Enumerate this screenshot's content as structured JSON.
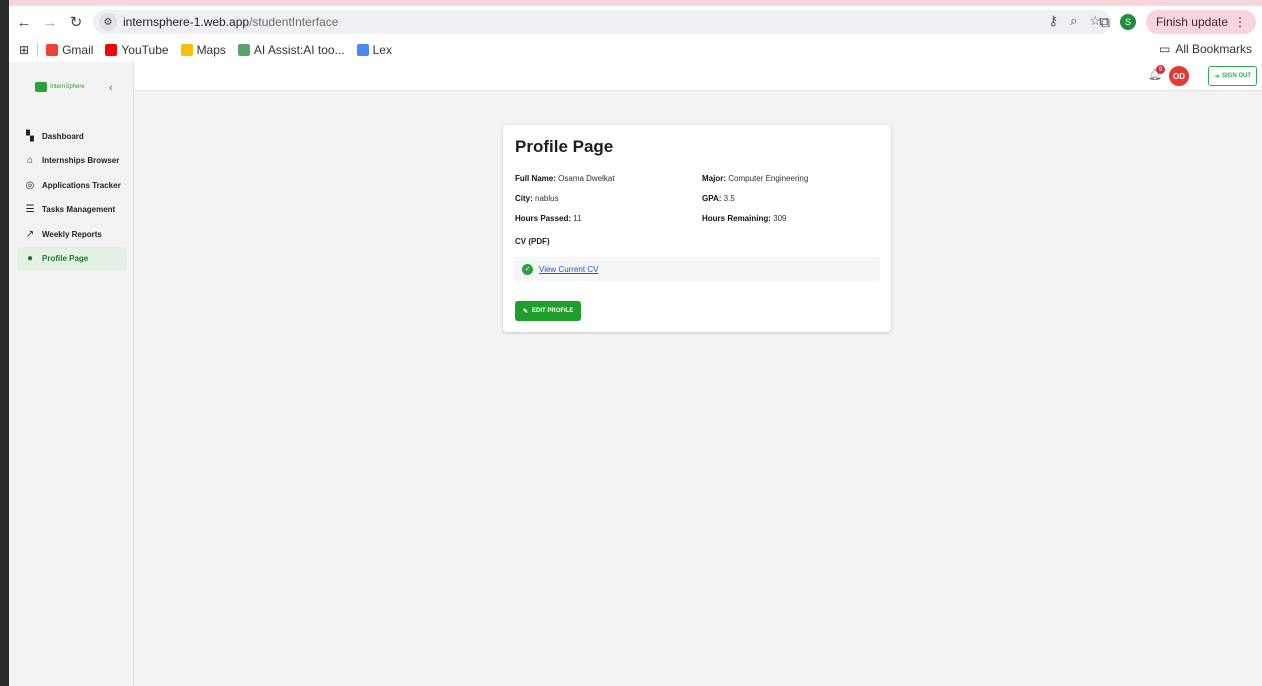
{
  "browser": {
    "url_host": "internsphere-1.web.app",
    "url_path": "/studentInterface",
    "profile_initial": "S",
    "finish_update_label": "Finish update",
    "bookmarks": [
      {
        "label": "Gmail",
        "color": "#ea4335"
      },
      {
        "label": "YouTube",
        "color": "#ff0000"
      },
      {
        "label": "Maps",
        "color": "#fbbc04"
      },
      {
        "label": "AI Assist:AI too...",
        "color": "#5aa469"
      },
      {
        "label": "Lex",
        "color": "#4a8af4"
      }
    ],
    "all_bookmarks_label": "All Bookmarks"
  },
  "app": {
    "brand_name": "InternSphere",
    "menu": [
      {
        "label": "Dashboard",
        "icon": "dashboard-icon",
        "glyph": "▚"
      },
      {
        "label": "Internships Browser",
        "icon": "briefcase-icon",
        "glyph": "⌂"
      },
      {
        "label": "Applications Tracker",
        "icon": "tracker-icon",
        "glyph": "◎"
      },
      {
        "label": "Tasks Management",
        "icon": "tasks-icon",
        "glyph": "☰"
      },
      {
        "label": "Weekly Reports",
        "icon": "trend-icon",
        "glyph": "↗"
      },
      {
        "label": "Profile Page",
        "icon": "account-icon",
        "glyph": "●"
      }
    ],
    "active_menu": "Profile Page",
    "notification_count": "9",
    "avatar_initials": "OD",
    "sign_out_label": "SIGN OUT"
  },
  "profile": {
    "title": "Profile Page",
    "full_name_label": "Full Name:",
    "full_name": "Osama Dwelkat",
    "major_label": "Major:",
    "major": "Computer Engineering",
    "city_label": "City:",
    "city": "nablus",
    "gpa_label": "GPA:",
    "gpa": "3.5",
    "hours_passed_label": "Hours Passed:",
    "hours_passed": "11",
    "hours_remaining_label": "Hours Remaining:",
    "hours_remaining": "309",
    "cv_title": "CV (PDF)",
    "cv_link": "View Current CV",
    "edit_button": "EDIT PROFILE"
  },
  "colors": {
    "brand_green": "#2e9e3f",
    "edit_button": "#1e9e2a",
    "avatar_red": "#e53935"
  }
}
